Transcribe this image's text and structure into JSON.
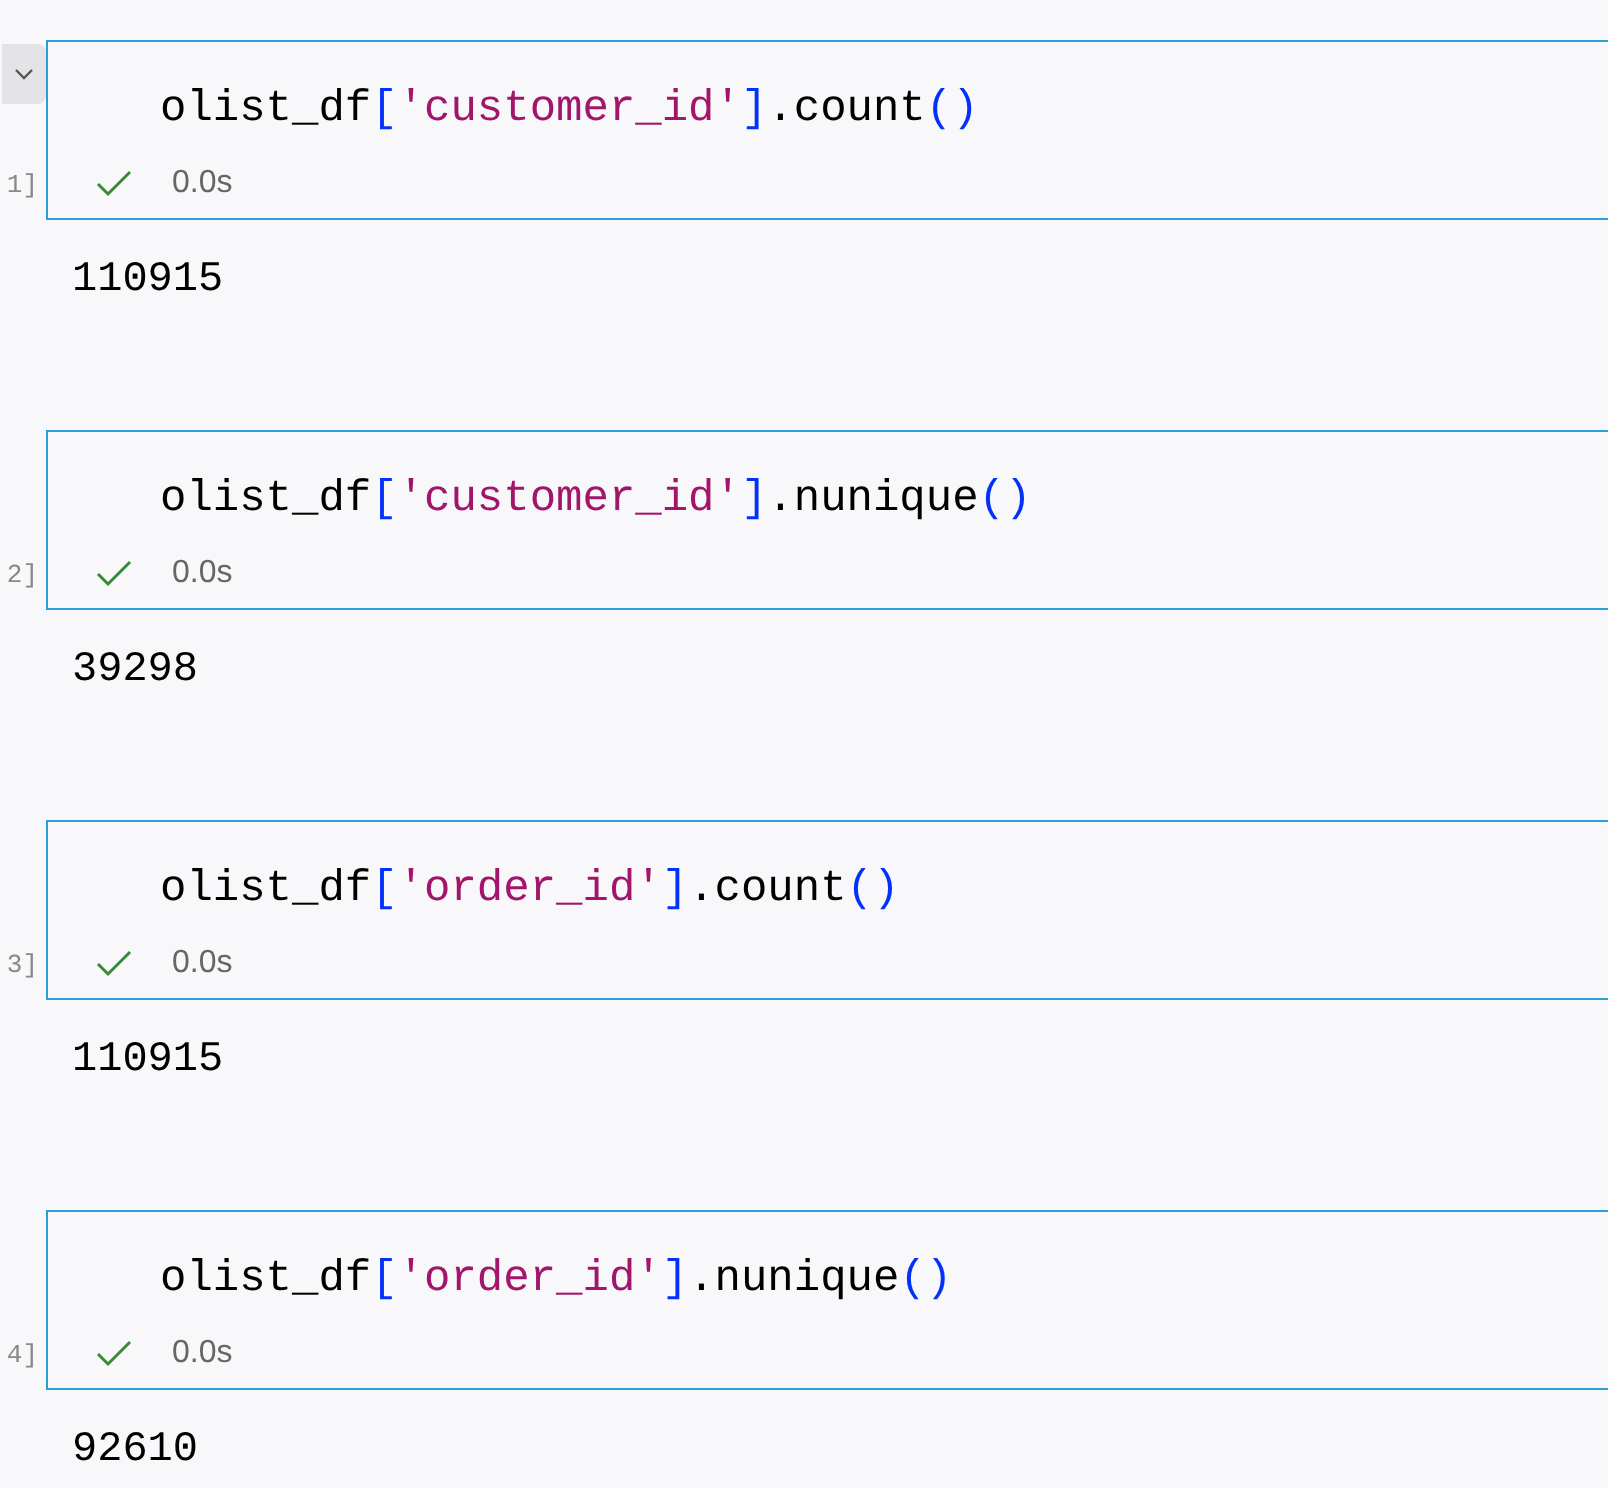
{
  "cells": [
    {
      "focused": true,
      "execution_count": "1]",
      "code": [
        {
          "kind": "name",
          "text": "olist_df"
        },
        {
          "kind": "bracket",
          "text": "["
        },
        {
          "kind": "string",
          "text": "'customer_id'"
        },
        {
          "kind": "bracket",
          "text": "]"
        },
        {
          "kind": "name",
          "text": ".count"
        },
        {
          "kind": "paren",
          "text": "()"
        }
      ],
      "success": true,
      "duration": "0.0s",
      "output": "110915"
    },
    {
      "focused": false,
      "execution_count": "2]",
      "code": [
        {
          "kind": "name",
          "text": "olist_df"
        },
        {
          "kind": "bracket",
          "text": "["
        },
        {
          "kind": "string",
          "text": "'customer_id'"
        },
        {
          "kind": "bracket",
          "text": "]"
        },
        {
          "kind": "name",
          "text": ".nunique"
        },
        {
          "kind": "paren",
          "text": "()"
        }
      ],
      "success": true,
      "duration": "0.0s",
      "output": "39298"
    },
    {
      "focused": false,
      "execution_count": "3]",
      "code": [
        {
          "kind": "name",
          "text": "olist_df"
        },
        {
          "kind": "bracket",
          "text": "["
        },
        {
          "kind": "string",
          "text": "'order_id'"
        },
        {
          "kind": "bracket",
          "text": "]"
        },
        {
          "kind": "name",
          "text": ".count"
        },
        {
          "kind": "paren",
          "text": "()"
        }
      ],
      "success": true,
      "duration": "0.0s",
      "output": "110915"
    },
    {
      "focused": false,
      "execution_count": "4]",
      "code": [
        {
          "kind": "name",
          "text": "olist_df"
        },
        {
          "kind": "bracket",
          "text": "["
        },
        {
          "kind": "string",
          "text": "'order_id'"
        },
        {
          "kind": "bracket",
          "text": "]"
        },
        {
          "kind": "name",
          "text": ".nunique"
        },
        {
          "kind": "paren",
          "text": "()"
        }
      ],
      "success": true,
      "duration": "0.0s",
      "output": "92610"
    }
  ]
}
